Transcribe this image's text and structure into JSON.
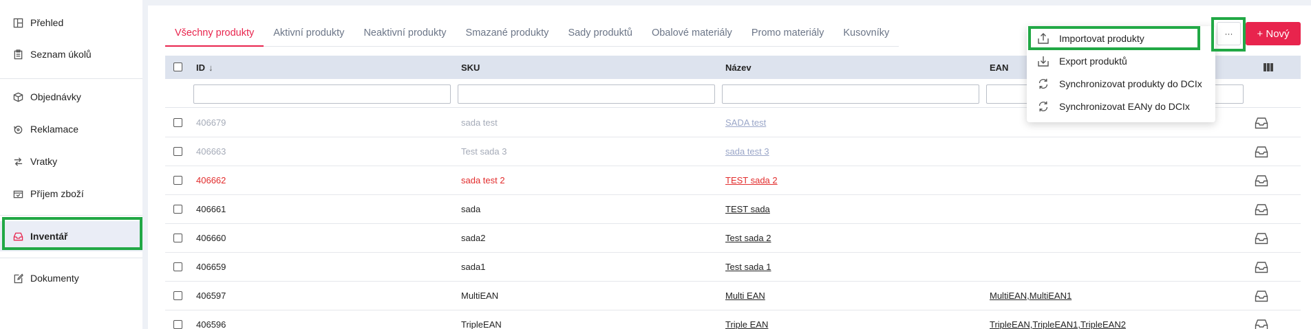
{
  "sidebar": {
    "items": [
      {
        "label": "Přehled",
        "icon": "layout-icon"
      },
      {
        "label": "Seznam úkolů",
        "icon": "clipboard-icon"
      },
      {
        "label": "Objednávky",
        "icon": "box-icon"
      },
      {
        "label": "Reklamace",
        "icon": "refund-icon"
      },
      {
        "label": "Vratky",
        "icon": "return-arrows-icon"
      },
      {
        "label": "Příjem zboží",
        "icon": "receive-icon"
      },
      {
        "label": "Inventář",
        "icon": "inbox-icon"
      },
      {
        "label": "Dokumenty",
        "icon": "document-edit-icon"
      }
    ]
  },
  "tabs": [
    "Všechny produkty",
    "Aktivní produkty",
    "Neaktivní produkty",
    "Smazané produkty",
    "Sady produktů",
    "Obalové materiály",
    "Promo materiály",
    "Kusovníky"
  ],
  "toolbar": {
    "more_label": "···",
    "new_label": "+ Nový"
  },
  "menu": [
    {
      "label": "Importovat produkty",
      "icon": "upload-icon"
    },
    {
      "label": "Export produktů",
      "icon": "download-icon"
    },
    {
      "label": "Synchronizovat produkty do DCIx",
      "icon": "sync-icon"
    },
    {
      "label": "Synchronizovat EANy do DCIx",
      "icon": "sync-icon"
    }
  ],
  "table": {
    "headers": {
      "id": "ID",
      "sort_arrow": "↓",
      "sku": "SKU",
      "name": "Název",
      "ean": "EAN"
    },
    "rows": [
      {
        "id": "406679",
        "sku": "sada test",
        "name": "SADA test",
        "ean": "",
        "state": "deleted"
      },
      {
        "id": "406663",
        "sku": "Test sada 3",
        "name": "sada test 3",
        "ean": "",
        "state": "deleted"
      },
      {
        "id": "406662",
        "sku": "sada test 2",
        "name": "TEST sada 2",
        "ean": "",
        "state": "inactive"
      },
      {
        "id": "406661",
        "sku": "sada",
        "name": "TEST sada",
        "ean": "",
        "state": "active"
      },
      {
        "id": "406660",
        "sku": "sada2",
        "name": "Test sada 2",
        "ean": "",
        "state": "active"
      },
      {
        "id": "406659",
        "sku": "sada1",
        "name": "Test sada 1",
        "ean": "",
        "state": "active"
      },
      {
        "id": "406597",
        "sku": "MultiEAN",
        "name": "Multi EAN",
        "ean": "MultiEAN,MultiEAN1",
        "state": "active"
      },
      {
        "id": "406596",
        "sku": "TripleEAN",
        "name": "Triple EAN",
        "ean": "TripleEAN,TripleEAN1,TripleEAN2",
        "state": "active"
      }
    ]
  },
  "colors": {
    "accent": "#e8244d",
    "highlight": "#21a845",
    "header_bg": "#dde3ee",
    "inactive_text": "#e22b2b"
  }
}
